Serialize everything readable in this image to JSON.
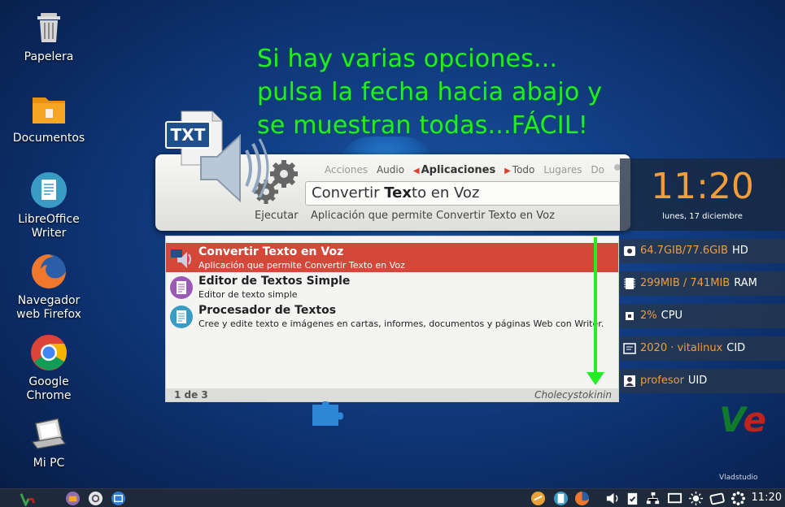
{
  "desktop": {
    "icons": [
      {
        "label_line1": "Papelera",
        "label_line2": ""
      },
      {
        "label_line1": "Documentos",
        "label_line2": ""
      },
      {
        "label_line1": "LibreOffice",
        "label_line2": "Writer"
      },
      {
        "label_line1": "Navegador",
        "label_line2": "web Firefox"
      },
      {
        "label_line1": "Google",
        "label_line2": "Chrome"
      },
      {
        "label_line1": "Mi PC",
        "label_line2": ""
      }
    ]
  },
  "annotation": {
    "line1": "Si hay varias opciones...",
    "line2": "pulsa la fecha hacia abajo y",
    "line3": "se muestran todas...FÁCIL!"
  },
  "runner": {
    "categories": [
      "Acciones",
      "Audio",
      "Aplicaciones",
      "Todo",
      "Lugares",
      "Do"
    ],
    "active_category": "Aplicaciones",
    "query_prefix": "Convertir ",
    "query_bold": "Tex",
    "query_suffix": "to en Voz",
    "action_label": "Ejecutar",
    "action_description": "Aplicación que permite Convertir Texto en Voz",
    "icon_badge": "TXT"
  },
  "results": [
    {
      "title": "Convertir Texto en Voz",
      "subtitle": "Aplicación que permite Convertir Texto en Voz",
      "selected": true
    },
    {
      "title": "Editor de Textos Simple",
      "subtitle": "Editor de texto simple",
      "selected": false
    },
    {
      "title": "Procesador de Textos",
      "subtitle": "Cree y edite texto e imágenes en cartas, informes, documentos y páginas Web con Writer.",
      "selected": false
    }
  ],
  "status": {
    "count": "1 de 3",
    "right_text": "Cholecystokinin"
  },
  "conky": {
    "time": "11:20",
    "date": "lunes, 17 diciembre",
    "hd_value": "64.7GIB/77.6GIB",
    "hd_label": "HD",
    "ram_value": "299MIB / 741MIB",
    "ram_label": "RAM",
    "cpu_value": "2%",
    "cpu_label": "CPU",
    "cid_value": "2020 · vitalinux",
    "cid_label": "CID",
    "uid_value": "profesor",
    "uid_label": "UID"
  },
  "brand": {
    "vlad": "Vladstudio"
  },
  "taskbar": {
    "clock": "11:20"
  },
  "colors": {
    "annotation": "#22ee22",
    "selection": "#d4483a",
    "accent": "#f39c3a"
  }
}
